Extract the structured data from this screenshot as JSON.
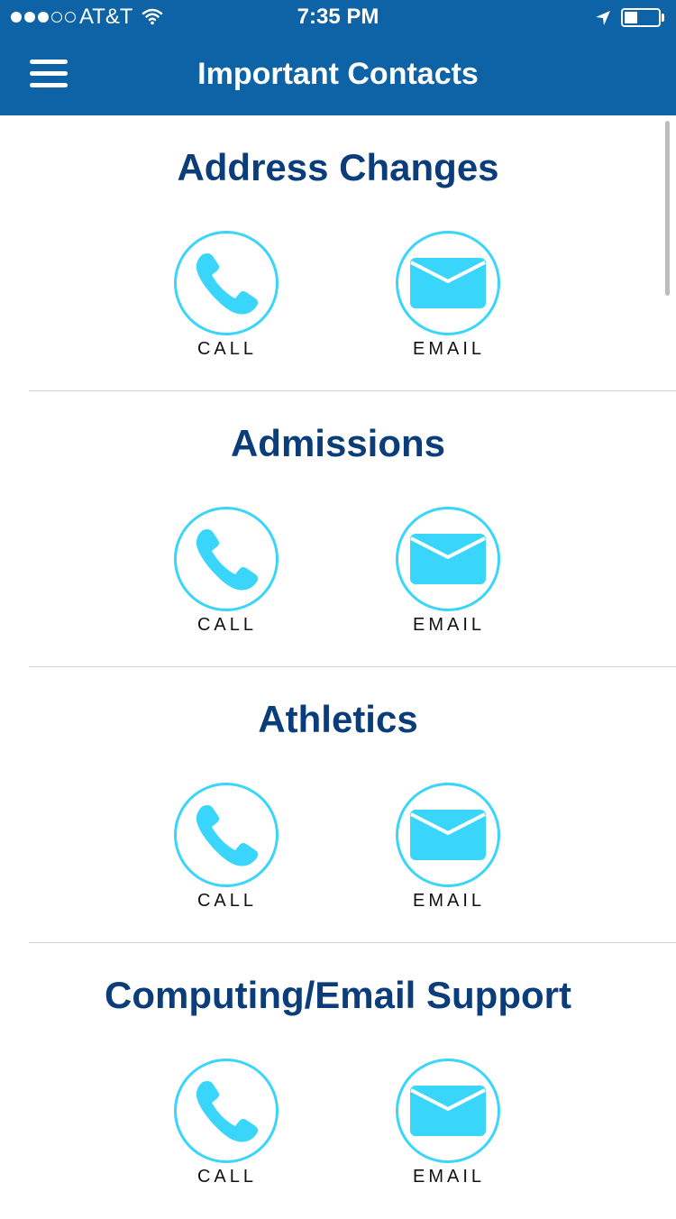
{
  "status_bar": {
    "signal_bars_filled": 3,
    "signal_bars_total": 5,
    "carrier": "AT&T",
    "time": "7:35 PM",
    "battery_level": 0.4
  },
  "header": {
    "title": "Important Contacts",
    "menu_icon": "hamburger-icon"
  },
  "colors": {
    "header_bg": "#0d63a6",
    "section_title": "#0a3d7a",
    "accent": "#3ad5fb"
  },
  "contacts": [
    {
      "title": "Address Changes",
      "call_label": "CALL",
      "email_label": "EMAIL"
    },
    {
      "title": "Admissions",
      "call_label": "CALL",
      "email_label": "EMAIL"
    },
    {
      "title": "Athletics",
      "call_label": "CALL",
      "email_label": "EMAIL"
    },
    {
      "title": "Computing/Email Support",
      "call_label": "CALL",
      "email_label": "EMAIL"
    }
  ],
  "icons": {
    "call": "phone-icon",
    "email": "envelope-icon"
  }
}
